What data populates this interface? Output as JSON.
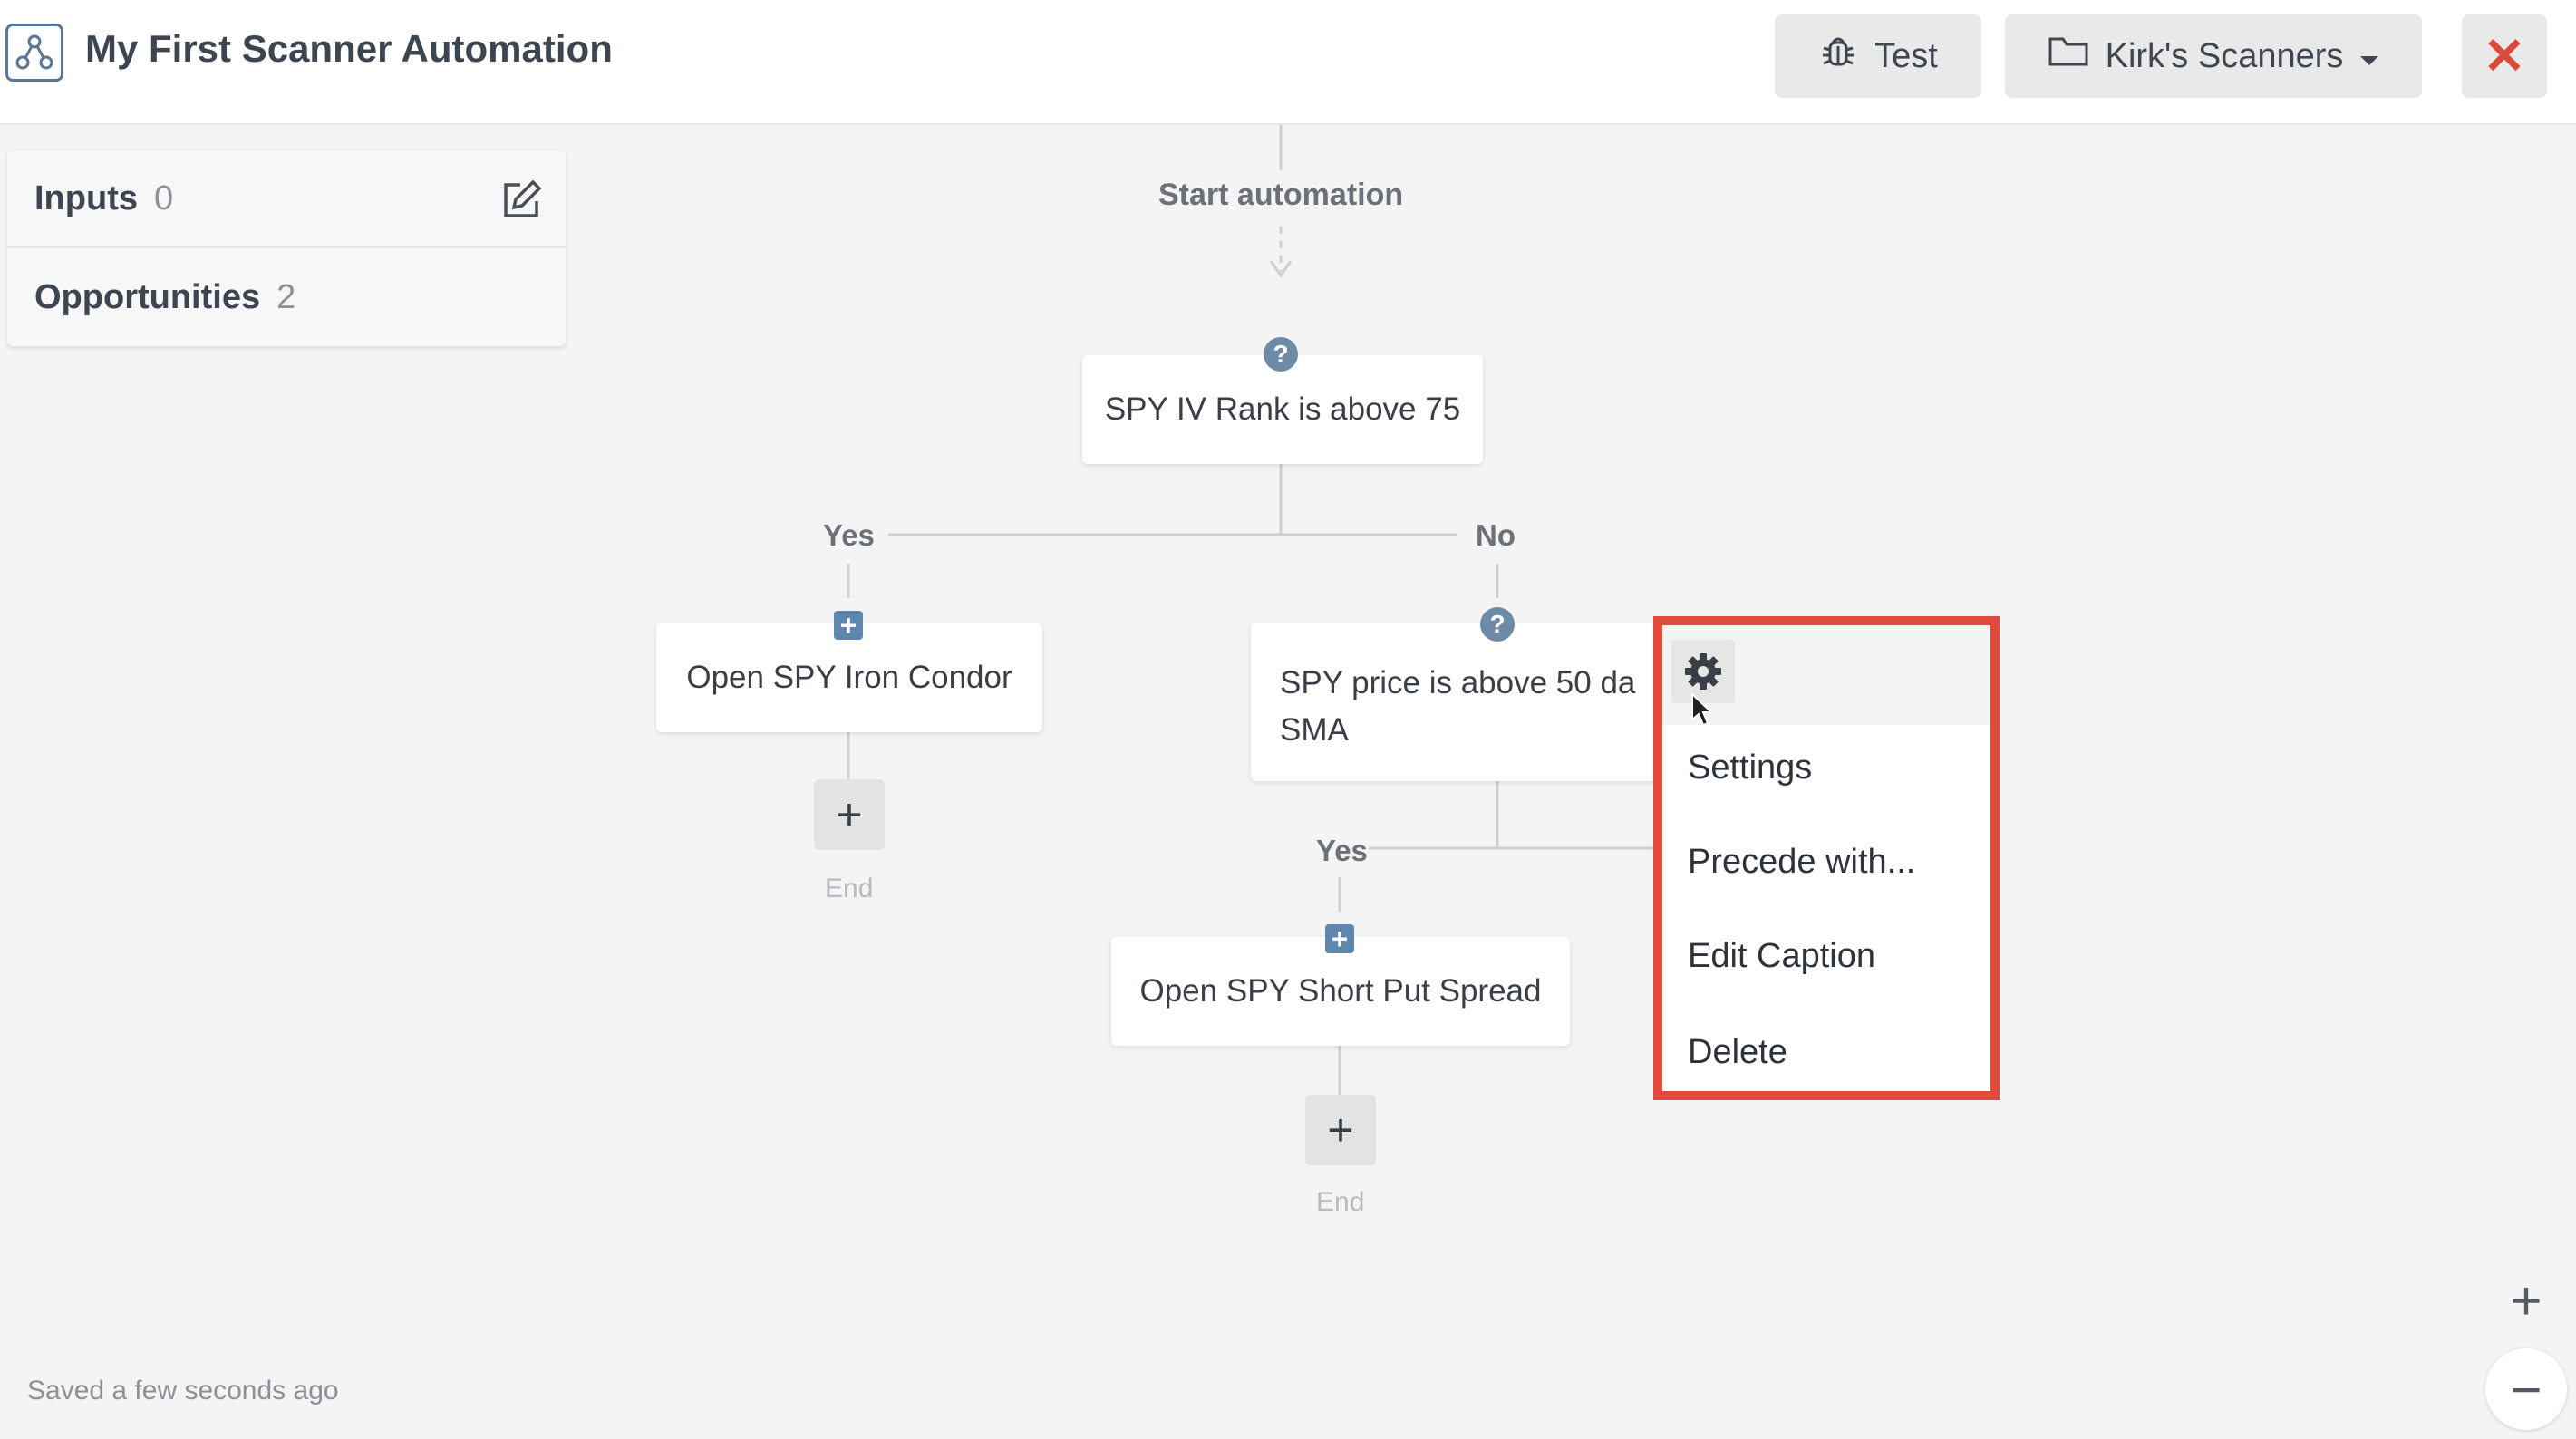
{
  "header": {
    "title": "My First Scanner Automation",
    "test_label": "Test",
    "folder_label": "Kirk's Scanners",
    "close_glyph": "✕"
  },
  "side_panel": {
    "inputs": {
      "label": "Inputs",
      "count": "0"
    },
    "opportunities": {
      "label": "Opportunities",
      "count": "2"
    }
  },
  "flow": {
    "start_label": "Start automation",
    "condition_1": "SPY IV Rank is above 75",
    "branch_yes": "Yes",
    "branch_no": "No",
    "action_1": "Open SPY Iron Condor",
    "condition_2_line1": "SPY price is above 50 da",
    "condition_2_line2": "SMA",
    "branch_yes_2": "Yes",
    "action_2": "Open SPY Short Put Spread",
    "add_glyph": "+",
    "end_label": "End"
  },
  "context_menu": {
    "items": [
      "Settings",
      "Precede with...",
      "Edit Caption",
      "Delete"
    ]
  },
  "footer": {
    "save_status": "Saved a few seconds ago",
    "zoom_in": "+",
    "zoom_out": "−"
  },
  "colors": {
    "accent_red": "#e04a3d",
    "icon_blue": "#6d8aa6",
    "background": "#f4f4f4"
  },
  "icons": [
    "automation-logo-icon",
    "bug-icon",
    "folder-icon",
    "caret-down-icon",
    "close-icon",
    "edit-icon",
    "question-icon",
    "plus-square-icon",
    "gear-icon",
    "cursor-icon"
  ]
}
